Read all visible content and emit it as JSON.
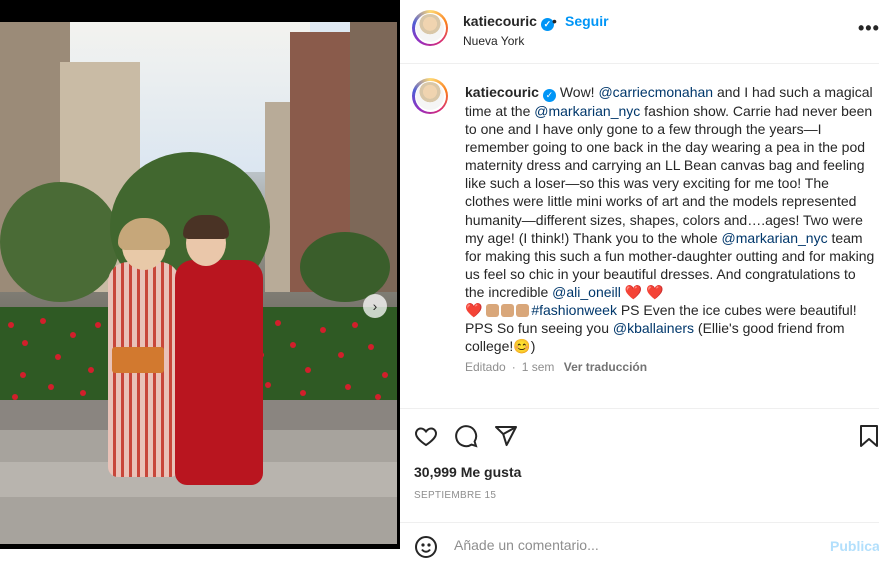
{
  "post": {
    "username": "katiecouric",
    "follow_label": "Seguir",
    "separator": "•",
    "location": "Nueva York",
    "more_label": "•••"
  },
  "caption": {
    "username": "katiecouric",
    "t1": "Wow! ",
    "m1": "@carriecmonahan",
    "t2": " and I had such a magical time at the ",
    "m2": "@markarian_nyc",
    "t3": " fashion show. Carrie had never been to one and I have only gone to a few through the years—I remember going to one back in the day wearing a pea in the pod maternity dress and carrying an LL Bean canvas bag and feeling like such a loser—so this was very exciting for me too! The clothes were little mini works of art and the models represented humanity—different sizes, shapes, colors and….ages! Two were my age! (I think!) Thank you to the whole ",
    "m3": "@markarian_nyc",
    "t4": " team for making this such a fun mother-daughter outting and for making us feel so chic in your beautiful dresses. And congratulations to the incredible ",
    "m4": "@ali_oneill",
    "hearts1": " ❤️ ❤️",
    "hearts2": "❤️ ",
    "m5": "#fashionweek",
    "t5": " PS Even the ice cubes were beautiful! PPS So fun seeing you ",
    "m6": "@kballainers",
    "t6": " (Ellie's good friend from college!",
    "smile": "😊",
    "t7": ")",
    "edited": "Editado",
    "age": "1 sem",
    "translate": "Ver traducción"
  },
  "actions": {
    "likes": "30,999 Me gusta",
    "date": "SEPTIEMBRE 15"
  },
  "comment_box": {
    "placeholder": "Añade un comentario...",
    "publish": "Publicar"
  },
  "carousel": {
    "next_label": "›",
    "slide_count": 7,
    "active_slide": 1
  },
  "colors": {
    "link": "#00376b",
    "accent": "#0095f6",
    "publish_disabled": "#b2dffc",
    "heart": "#e0245e"
  },
  "icons": [
    "verified-badge-icon",
    "more-options-icon",
    "next-slide-icon",
    "heart-icon",
    "comment-icon",
    "share-icon",
    "bookmark-icon",
    "smiley-icon"
  ]
}
